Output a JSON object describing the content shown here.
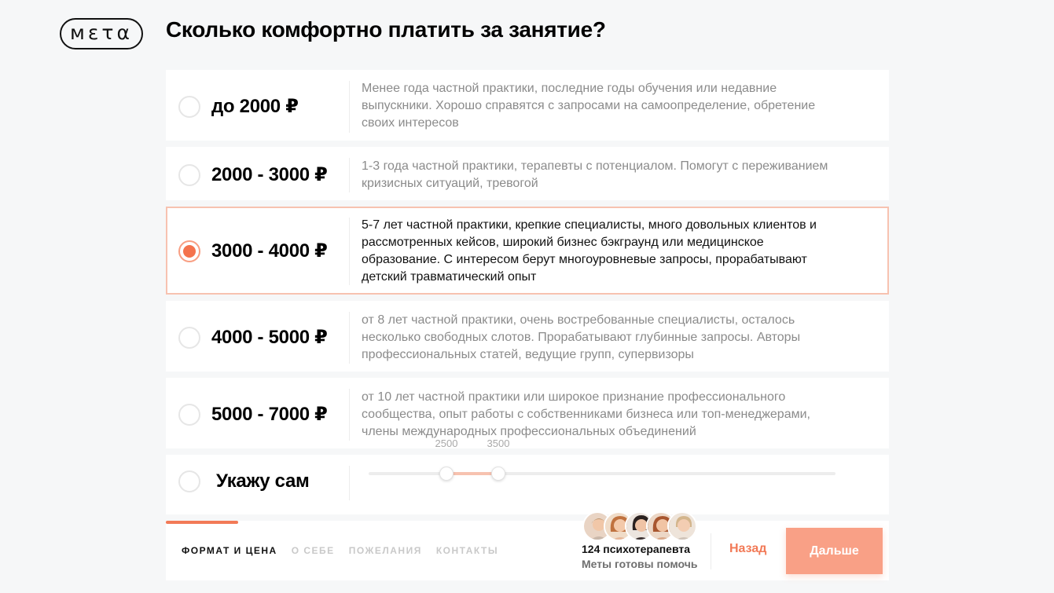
{
  "brand": {
    "logo_text": "мετα"
  },
  "page": {
    "title": "Сколько комфортно платить за занятие?"
  },
  "options": [
    {
      "price": "до 2000 ₽",
      "description": "Менее года частной практики, последние годы обучения или недавние выпускники. Хорошо справятся с запросами на самоопределение, обретение своих интересов",
      "selected": false
    },
    {
      "price": "2000 - 3000 ₽",
      "description": "1-3 года частной практики, терапевты с потенциалом. Помогут с переживанием кризисных ситуаций, тревогой",
      "selected": false
    },
    {
      "price": "3000 - 4000 ₽",
      "description": "5-7 лет частной практики, крепкие специалисты, много довольных клиентов и рассмотренных кейсов, широкий бизнес бэкграунд или медицинское образование. С интересом берут многоуровневые запросы, прорабатывают детский травматический опыт",
      "selected": true
    },
    {
      "price": "4000 - 5000 ₽",
      "description": "от 8 лет частной практики, очень востребованные специалисты, осталось несколько свободных слотов. Прорабатывают глубинные запросы. Авторы профессиональных статей, ведущие групп, супервизоры",
      "selected": false
    },
    {
      "price": "5000 - 7000 ₽",
      "description": "от 10 лет частной практики или широкое признание профессионального сообщества, опыт работы с собственниками бизнеса или топ-менеджерами, члены международных профессиональных объединений",
      "selected": false
    }
  ],
  "custom_option": {
    "label": "Укажу сам",
    "selected": false,
    "slider": {
      "min_value": "2500",
      "max_value": "3500"
    }
  },
  "footer": {
    "steps": [
      {
        "label": "ФОРМАТ И ЦЕНА",
        "active": true
      },
      {
        "label": "О СЕБЕ",
        "active": false
      },
      {
        "label": "ПОЖЕЛАНИЯ",
        "active": false
      },
      {
        "label": "КОНТАКТЫ",
        "active": false
      }
    ],
    "progress_fraction": 0.25,
    "therapist_count_text": "124 психотерапевта",
    "therapist_help_text": "Меты готовы помочь",
    "back_label": "Назад",
    "next_label": "Дальше"
  },
  "colors": {
    "accent": "#f27a57",
    "accent_light": "#f9a086",
    "selected_border": "#f7c2b0",
    "background": "#f6f7f8"
  }
}
